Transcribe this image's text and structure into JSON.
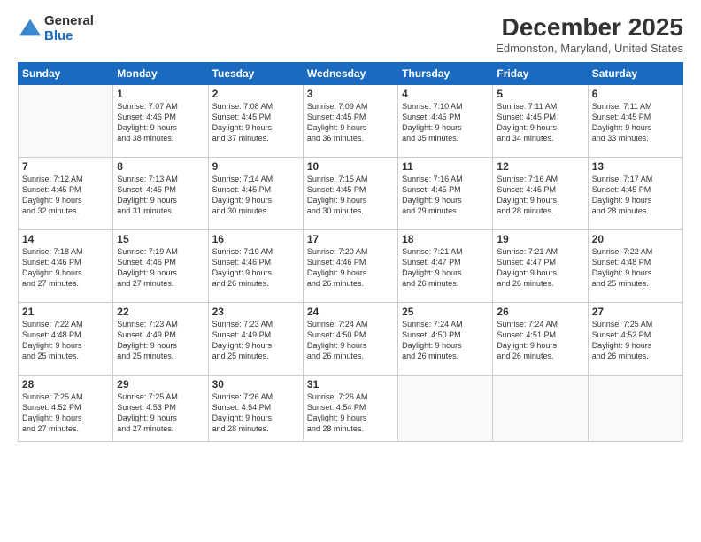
{
  "logo": {
    "general": "General",
    "blue": "Blue"
  },
  "header": {
    "month": "December 2025",
    "location": "Edmonston, Maryland, United States"
  },
  "days": [
    "Sunday",
    "Monday",
    "Tuesday",
    "Wednesday",
    "Thursday",
    "Friday",
    "Saturday"
  ],
  "weeks": [
    [
      {
        "day": "",
        "content": ""
      },
      {
        "day": "1",
        "content": "Sunrise: 7:07 AM\nSunset: 4:46 PM\nDaylight: 9 hours\nand 38 minutes."
      },
      {
        "day": "2",
        "content": "Sunrise: 7:08 AM\nSunset: 4:45 PM\nDaylight: 9 hours\nand 37 minutes."
      },
      {
        "day": "3",
        "content": "Sunrise: 7:09 AM\nSunset: 4:45 PM\nDaylight: 9 hours\nand 36 minutes."
      },
      {
        "day": "4",
        "content": "Sunrise: 7:10 AM\nSunset: 4:45 PM\nDaylight: 9 hours\nand 35 minutes."
      },
      {
        "day": "5",
        "content": "Sunrise: 7:11 AM\nSunset: 4:45 PM\nDaylight: 9 hours\nand 34 minutes."
      },
      {
        "day": "6",
        "content": "Sunrise: 7:11 AM\nSunset: 4:45 PM\nDaylight: 9 hours\nand 33 minutes."
      }
    ],
    [
      {
        "day": "7",
        "content": "Sunrise: 7:12 AM\nSunset: 4:45 PM\nDaylight: 9 hours\nand 32 minutes."
      },
      {
        "day": "8",
        "content": "Sunrise: 7:13 AM\nSunset: 4:45 PM\nDaylight: 9 hours\nand 31 minutes."
      },
      {
        "day": "9",
        "content": "Sunrise: 7:14 AM\nSunset: 4:45 PM\nDaylight: 9 hours\nand 30 minutes."
      },
      {
        "day": "10",
        "content": "Sunrise: 7:15 AM\nSunset: 4:45 PM\nDaylight: 9 hours\nand 30 minutes."
      },
      {
        "day": "11",
        "content": "Sunrise: 7:16 AM\nSunset: 4:45 PM\nDaylight: 9 hours\nand 29 minutes."
      },
      {
        "day": "12",
        "content": "Sunrise: 7:16 AM\nSunset: 4:45 PM\nDaylight: 9 hours\nand 28 minutes."
      },
      {
        "day": "13",
        "content": "Sunrise: 7:17 AM\nSunset: 4:45 PM\nDaylight: 9 hours\nand 28 minutes."
      }
    ],
    [
      {
        "day": "14",
        "content": "Sunrise: 7:18 AM\nSunset: 4:46 PM\nDaylight: 9 hours\nand 27 minutes."
      },
      {
        "day": "15",
        "content": "Sunrise: 7:19 AM\nSunset: 4:46 PM\nDaylight: 9 hours\nand 27 minutes."
      },
      {
        "day": "16",
        "content": "Sunrise: 7:19 AM\nSunset: 4:46 PM\nDaylight: 9 hours\nand 26 minutes."
      },
      {
        "day": "17",
        "content": "Sunrise: 7:20 AM\nSunset: 4:46 PM\nDaylight: 9 hours\nand 26 minutes."
      },
      {
        "day": "18",
        "content": "Sunrise: 7:21 AM\nSunset: 4:47 PM\nDaylight: 9 hours\nand 26 minutes."
      },
      {
        "day": "19",
        "content": "Sunrise: 7:21 AM\nSunset: 4:47 PM\nDaylight: 9 hours\nand 26 minutes."
      },
      {
        "day": "20",
        "content": "Sunrise: 7:22 AM\nSunset: 4:48 PM\nDaylight: 9 hours\nand 25 minutes."
      }
    ],
    [
      {
        "day": "21",
        "content": "Sunrise: 7:22 AM\nSunset: 4:48 PM\nDaylight: 9 hours\nand 25 minutes."
      },
      {
        "day": "22",
        "content": "Sunrise: 7:23 AM\nSunset: 4:49 PM\nDaylight: 9 hours\nand 25 minutes."
      },
      {
        "day": "23",
        "content": "Sunrise: 7:23 AM\nSunset: 4:49 PM\nDaylight: 9 hours\nand 25 minutes."
      },
      {
        "day": "24",
        "content": "Sunrise: 7:24 AM\nSunset: 4:50 PM\nDaylight: 9 hours\nand 26 minutes."
      },
      {
        "day": "25",
        "content": "Sunrise: 7:24 AM\nSunset: 4:50 PM\nDaylight: 9 hours\nand 26 minutes."
      },
      {
        "day": "26",
        "content": "Sunrise: 7:24 AM\nSunset: 4:51 PM\nDaylight: 9 hours\nand 26 minutes."
      },
      {
        "day": "27",
        "content": "Sunrise: 7:25 AM\nSunset: 4:52 PM\nDaylight: 9 hours\nand 26 minutes."
      }
    ],
    [
      {
        "day": "28",
        "content": "Sunrise: 7:25 AM\nSunset: 4:52 PM\nDaylight: 9 hours\nand 27 minutes."
      },
      {
        "day": "29",
        "content": "Sunrise: 7:25 AM\nSunset: 4:53 PM\nDaylight: 9 hours\nand 27 minutes."
      },
      {
        "day": "30",
        "content": "Sunrise: 7:26 AM\nSunset: 4:54 PM\nDaylight: 9 hours\nand 28 minutes."
      },
      {
        "day": "31",
        "content": "Sunrise: 7:26 AM\nSunset: 4:54 PM\nDaylight: 9 hours\nand 28 minutes."
      },
      {
        "day": "",
        "content": ""
      },
      {
        "day": "",
        "content": ""
      },
      {
        "day": "",
        "content": ""
      }
    ]
  ]
}
